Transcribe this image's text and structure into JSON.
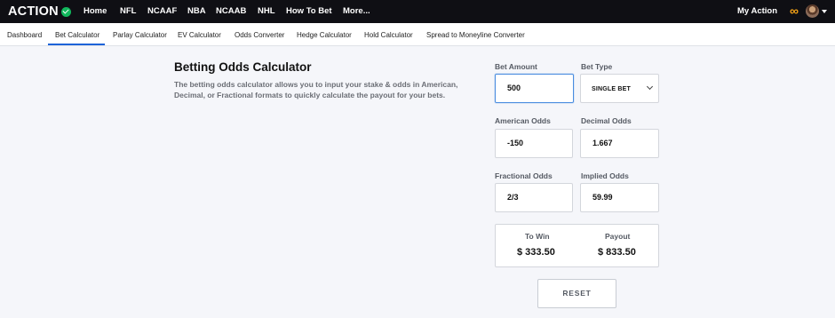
{
  "nav": {
    "brand": "ACTION",
    "items": [
      {
        "label": "Home"
      },
      {
        "label": "NFL"
      },
      {
        "label": "NCAAF"
      },
      {
        "label": "NBA"
      },
      {
        "label": "NCAAB"
      },
      {
        "label": "NHL"
      },
      {
        "label": "How To Bet"
      },
      {
        "label": "More..."
      }
    ],
    "my_action": "My Action",
    "infinity_glyph": "∞"
  },
  "tabs": [
    {
      "label": "Dashboard"
    },
    {
      "label": "Bet Calculator",
      "active": true
    },
    {
      "label": "Parlay Calculator"
    },
    {
      "label": "EV Calculator"
    },
    {
      "label": "Odds Converter"
    },
    {
      "label": "Hedge Calculator"
    },
    {
      "label": "Hold Calculator"
    },
    {
      "label": "Spread to Moneyline Converter"
    }
  ],
  "intro": {
    "title": "Betting Odds Calculator",
    "description": "The betting odds calculator allows you to input your stake & odds in American, Decimal, or Fractional formats to quickly calculate the payout for your bets."
  },
  "form": {
    "bet_amount": {
      "label": "Bet Amount",
      "value": "500"
    },
    "bet_type": {
      "label": "Bet Type",
      "value": "SINGLE BET"
    },
    "american_odds": {
      "label": "American Odds",
      "value": "-150"
    },
    "decimal_odds": {
      "label": "Decimal Odds",
      "value": "1.667"
    },
    "fractional_odds": {
      "label": "Fractional Odds",
      "value": "2/3"
    },
    "implied_odds": {
      "label": "Implied Odds",
      "value": "59.99"
    }
  },
  "result": {
    "to_win_label": "To Win",
    "to_win_value": "$ 333.50",
    "payout_label": "Payout",
    "payout_value": "$ 833.50"
  },
  "reset_label": "RESET",
  "colors": {
    "nav_bg": "#0f0f14",
    "accent": "#1d63d8",
    "brand_check": "#11b85c",
    "infinity": "#f7a416",
    "page_bg": "#f5f6fa"
  }
}
